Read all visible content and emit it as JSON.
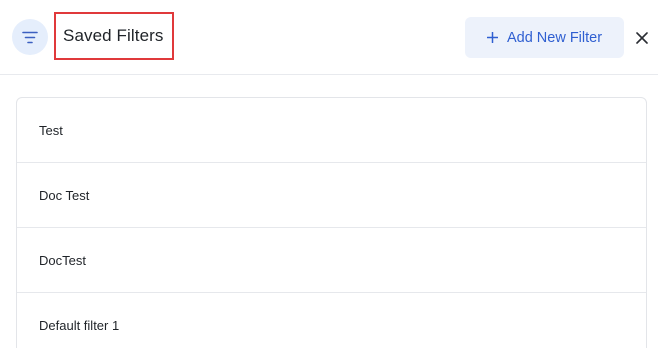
{
  "header": {
    "title": "Saved Filters",
    "add_button_label": "Add New Filter",
    "icons": {
      "filter": "filter-lines-icon",
      "add": "plus-icon",
      "close": "close-icon"
    },
    "colors": {
      "accent": "#2f5fd1",
      "icon_bg": "#e5eefc",
      "button_bg": "#edf2fb",
      "highlight_border": "#e0393b"
    }
  },
  "filters": [
    {
      "label": "Test"
    },
    {
      "label": "Doc Test"
    },
    {
      "label": "DocTest"
    },
    {
      "label": "Default filter 1"
    }
  ]
}
